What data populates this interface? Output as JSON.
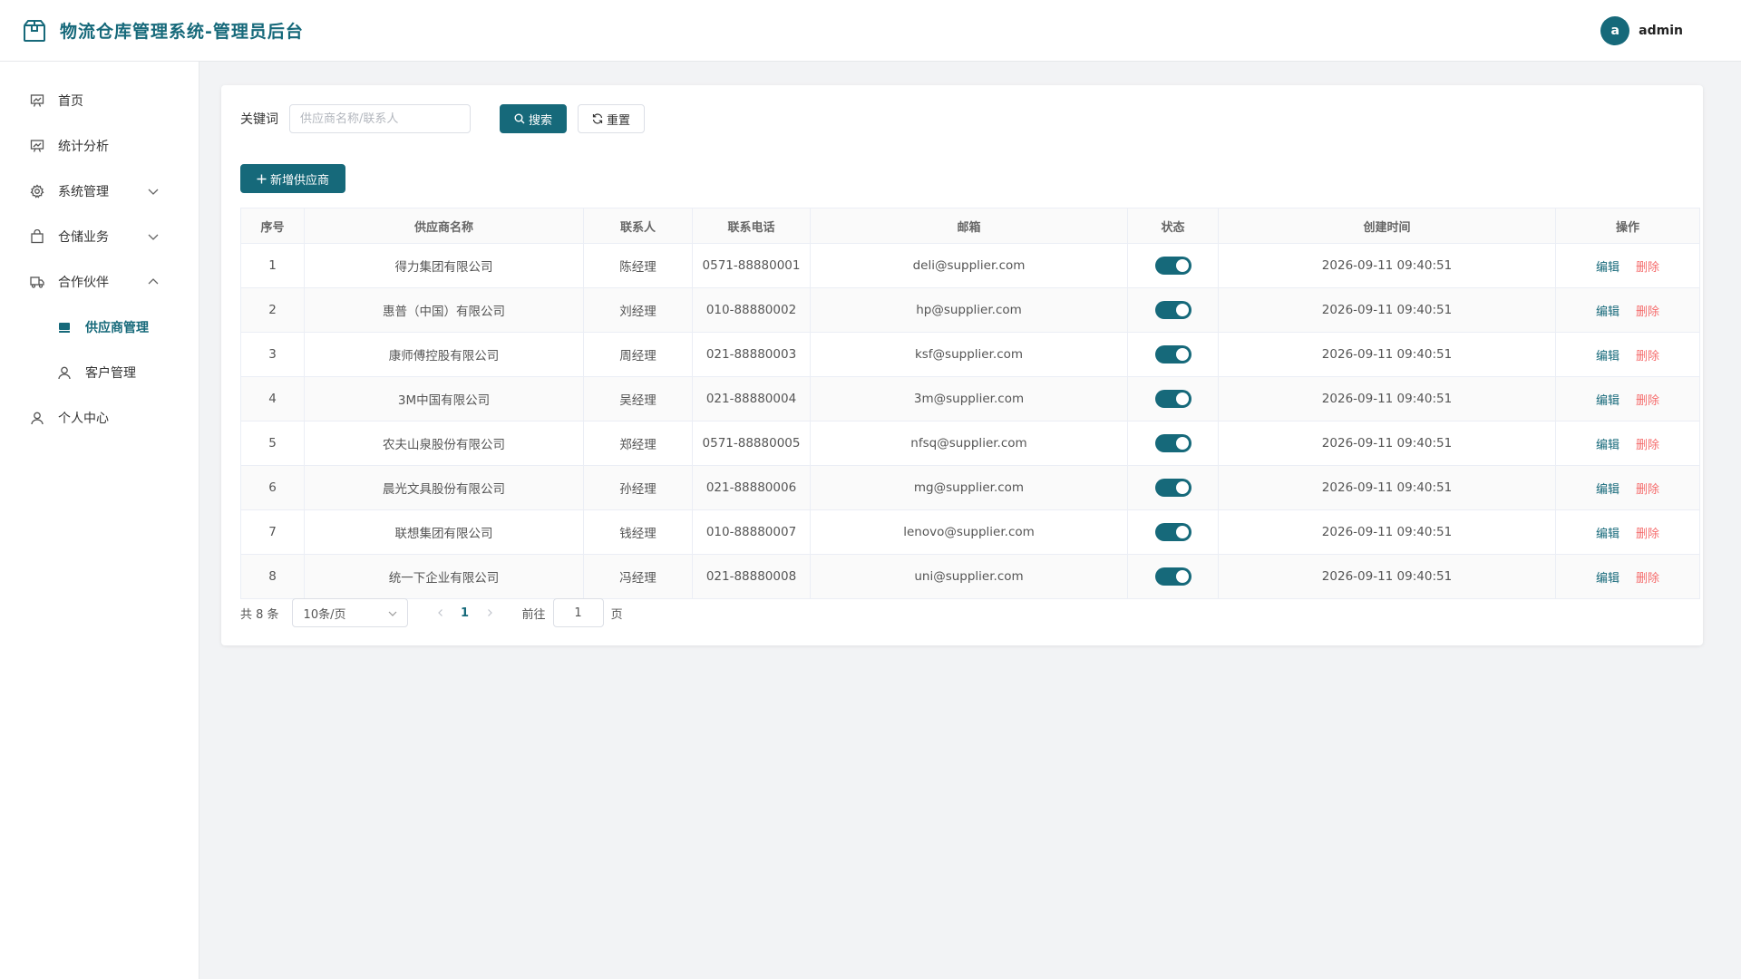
{
  "app": {
    "title": "物流仓库管理系统-管理员后台"
  },
  "user": {
    "avatar_letter": "a",
    "name": "admin"
  },
  "sidebar": {
    "items": [
      {
        "label": "首页",
        "icon": "presentation-icon"
      },
      {
        "label": "统计分析",
        "icon": "chart-icon"
      },
      {
        "label": "系统管理",
        "icon": "gear-icon",
        "expanded": false
      },
      {
        "label": "仓储业务",
        "icon": "bag-icon",
        "expanded": false
      },
      {
        "label": "合作伙伴",
        "icon": "truck-icon",
        "expanded": true
      },
      {
        "label": "供应商管理",
        "icon": "store-icon",
        "active": true
      },
      {
        "label": "客户管理",
        "icon": "user-icon"
      },
      {
        "label": "个人中心",
        "icon": "user-icon"
      }
    ]
  },
  "search": {
    "label": "关键词",
    "placeholder": "供应商名称/联系人",
    "value": "",
    "search_btn": "搜索",
    "reset_btn": "重置"
  },
  "toolbar": {
    "add_btn": "新增供应商"
  },
  "table": {
    "columns": [
      "序号",
      "供应商名称",
      "联系人",
      "联系电话",
      "邮箱",
      "状态",
      "创建时间",
      "操作"
    ],
    "actions": {
      "edit": "编辑",
      "delete": "删除"
    },
    "rows": [
      {
        "no": "1",
        "name": "得力集团有限公司",
        "contact": "陈经理",
        "phone": "0571-88880001",
        "email": "deli@supplier.com",
        "enabled": true,
        "created": "2026-09-11 09:40:51"
      },
      {
        "no": "2",
        "name": "惠普（中国）有限公司",
        "contact": "刘经理",
        "phone": "010-88880002",
        "email": "hp@supplier.com",
        "enabled": true,
        "created": "2026-09-11 09:40:51"
      },
      {
        "no": "3",
        "name": "康师傅控股有限公司",
        "contact": "周经理",
        "phone": "021-88880003",
        "email": "ksf@supplier.com",
        "enabled": true,
        "created": "2026-09-11 09:40:51"
      },
      {
        "no": "4",
        "name": "3M中国有限公司",
        "contact": "吴经理",
        "phone": "021-88880004",
        "email": "3m@supplier.com",
        "enabled": true,
        "created": "2026-09-11 09:40:51"
      },
      {
        "no": "5",
        "name": "农夫山泉股份有限公司",
        "contact": "郑经理",
        "phone": "0571-88880005",
        "email": "nfsq@supplier.com",
        "enabled": true,
        "created": "2026-09-11 09:40:51"
      },
      {
        "no": "6",
        "name": "晨光文具股份有限公司",
        "contact": "孙经理",
        "phone": "021-88880006",
        "email": "mg@supplier.com",
        "enabled": true,
        "created": "2026-09-11 09:40:51"
      },
      {
        "no": "7",
        "name": "联想集团有限公司",
        "contact": "钱经理",
        "phone": "010-88880007",
        "email": "lenovo@supplier.com",
        "enabled": true,
        "created": "2026-09-11 09:40:51"
      },
      {
        "no": "8",
        "name": "统一下企业有限公司",
        "contact": "冯经理",
        "phone": "021-88880008",
        "email": "uni@supplier.com",
        "enabled": true,
        "created": "2026-09-11 09:40:51"
      }
    ]
  },
  "pagination": {
    "total_text": "共 8 条",
    "page_size": "10条/页",
    "current_page": "1",
    "goto_label": "前往",
    "goto_value": "1",
    "page_unit": "页"
  },
  "colors": {
    "primary": "#16697a",
    "danger": "#f56c6c"
  }
}
